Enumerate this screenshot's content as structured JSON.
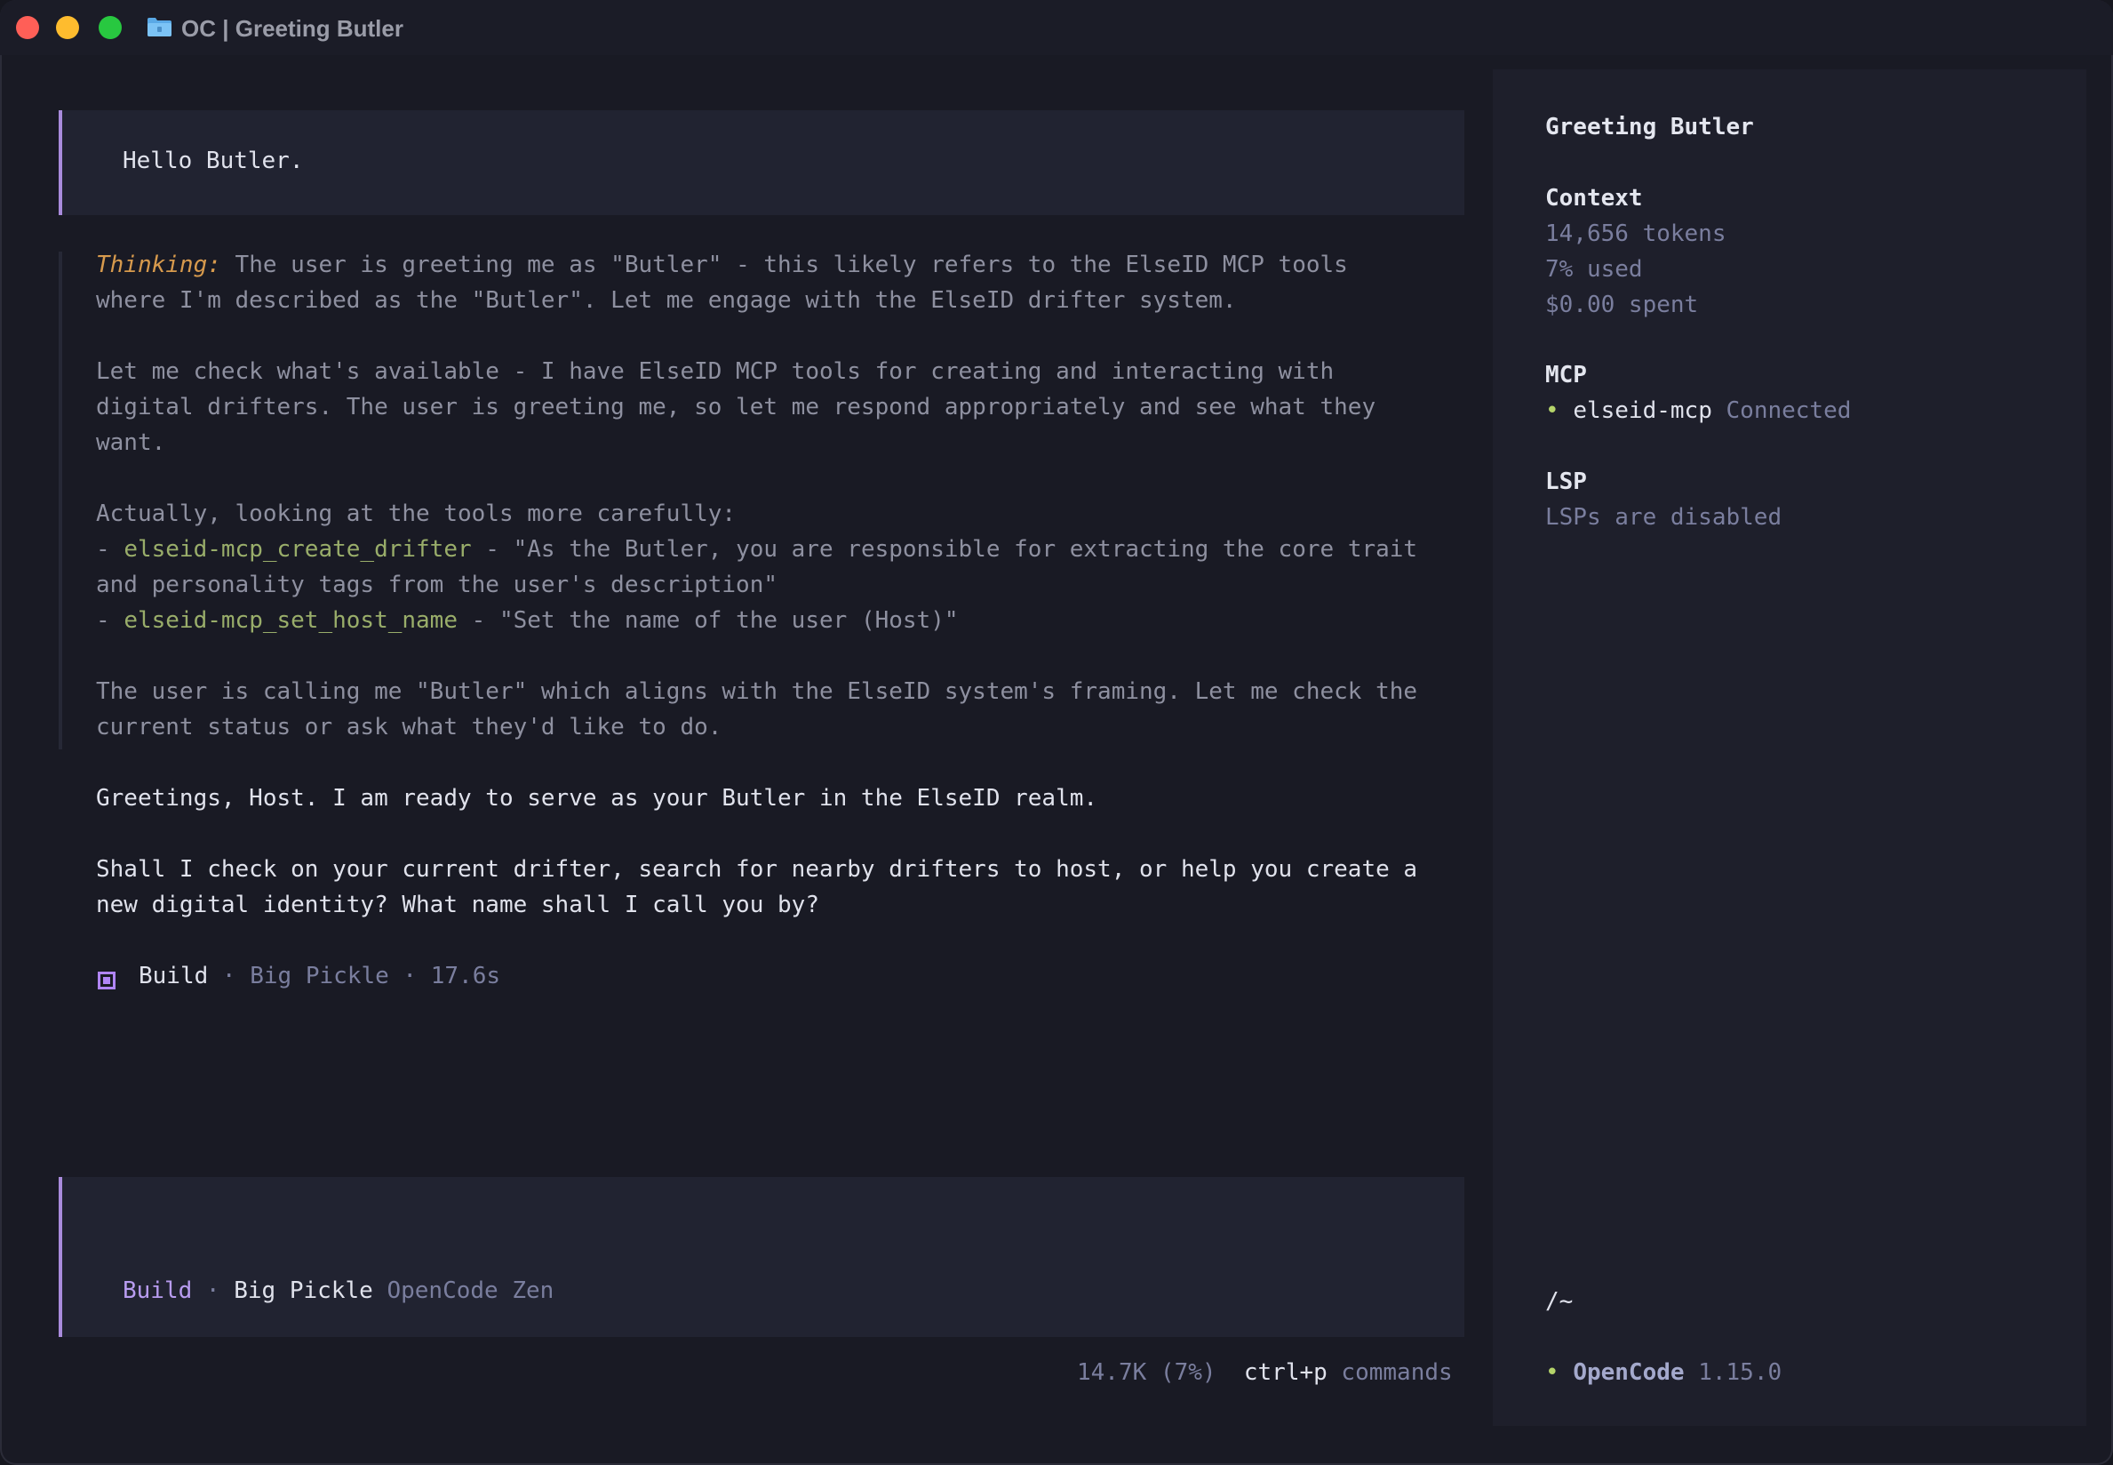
{
  "window": {
    "title": "OC | Greeting Butler",
    "folder_icon": "folder-icon",
    "controls": [
      "close",
      "minimize",
      "zoom"
    ]
  },
  "colors": {
    "accent": "#a98bdc",
    "thinking": "#d79a4d",
    "tool": "#99ad6a",
    "connected_dot": "#b5d46a"
  },
  "conversation": {
    "user_message": "Hello Butler.",
    "thinking_label": "Thinking:",
    "thinking_lines": [
      "The user is greeting me as \"Butler\" - this likely refers to the ElseID MCP tools",
      "where I'm described as the \"Butler\". Let me engage with the ElseID drifter system.",
      "Let me check what's available - I have ElseID MCP tools for creating and interacting with",
      "digital drifters. The user is greeting me, so let me respond appropriately and see what they",
      "want.",
      "Actually, looking at the tools more carefully:",
      "and personality tags from the user's description\"",
      "The user is calling me \"Butler\" which aligns with the ElseID system's framing. Let me check the",
      "current status or ask what they'd like to do."
    ],
    "tools": [
      {
        "dash": "- ",
        "name": "elseid-mcp_create_drifter",
        "desc": " - \"As the Butler, you are responsible for extracting the core trait"
      },
      {
        "dash": "- ",
        "name": "elseid-mcp_set_host_name",
        "desc": " - \"Set the name of the user (Host)\""
      }
    ],
    "response_lines": [
      "Greetings, Host. I am ready to serve as your Butler in the ElseID realm.",
      "Shall I check on your current drifter, search for nearby drifters to host, or help you create a",
      "new digital identity? What name shall I call you by?"
    ],
    "build_info": {
      "agent": "Build",
      "details": " · Big Pickle · 17.6s"
    }
  },
  "prompt": {
    "mode": "Build",
    "sep": " · ",
    "model": "Big Pickle",
    "provider": " OpenCode Zen"
  },
  "status_bar": {
    "usage": "14.7K (7%)",
    "shortcut": "ctrl+p",
    "shortcut_label": " commands"
  },
  "sidebar": {
    "title": "Greeting Butler",
    "context_heading": "Context",
    "tokens": "14,656 tokens",
    "used": "7% used",
    "spent": "$0.00 spent",
    "mcp_heading": "MCP",
    "mcp_bullet": "•",
    "mcp_server": "elseid-mcp",
    "mcp_status": " Connected",
    "lsp_heading": "LSP",
    "lsp_status": "LSPs are disabled",
    "path": "/~",
    "footer_bullet": "•",
    "app_name": "OpenCode",
    "version": " 1.15.0"
  }
}
